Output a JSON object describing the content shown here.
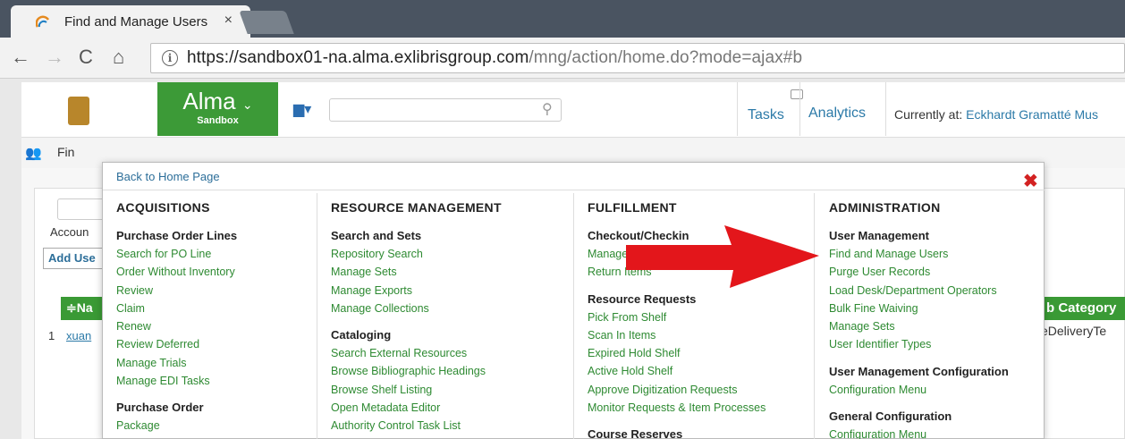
{
  "browser": {
    "tab_title": "Find and Manage Users",
    "tab_close": "×",
    "url_host": "https://sandbox01-na.alma.exlibrisgroup.com",
    "url_path": "/mng/action/home.do?mode=ajax#b"
  },
  "header": {
    "alma_name": "Alma",
    "alma_dropdown": "⌄",
    "alma_sub": "Sandbox",
    "tasks": "Tasks",
    "analytics": "Analytics",
    "currently_prefix": "Currently at:",
    "currently_location": "Eckhardt Gramatté Mus"
  },
  "subbar": {
    "text": "Fin"
  },
  "background": {
    "accoun": "Accoun",
    "add_use": "Add Use",
    "tbl_head": "≑Na",
    "row_num": "1",
    "row_link": "xuan",
    "right_head": "b Category",
    "right_cell": "eDeliveryTe"
  },
  "menu": {
    "back_home": "Back to Home Page",
    "close": "✖",
    "columns": [
      {
        "title": "ACQUISITIONS",
        "groups": [
          {
            "title": "Purchase Order Lines",
            "items": [
              "Search for PO Line",
              "Order Without Inventory",
              "Review",
              "Claim",
              "Renew",
              "Review Deferred",
              "Manage Trials",
              "Manage EDI Tasks"
            ]
          },
          {
            "title": "Purchase Order",
            "items": [
              "Package"
            ]
          }
        ]
      },
      {
        "title": "RESOURCE MANAGEMENT",
        "groups": [
          {
            "title": "Search and Sets",
            "items": [
              "Repository Search",
              "Manage Sets",
              "Manage Exports",
              "Manage Collections"
            ]
          },
          {
            "title": "Cataloging",
            "items": [
              "Search External Resources",
              "Browse Bibliographic Headings",
              "Browse Shelf Listing",
              "Open Metadata Editor",
              "Authority Control Task List"
            ]
          }
        ]
      },
      {
        "title": "FULFILLMENT",
        "groups": [
          {
            "title": "Checkout/Checkin",
            "items": [
              "Manage",
              "Return Items"
            ]
          },
          {
            "title": "Resource Requests",
            "items": [
              "Pick From Shelf",
              "Scan In Items",
              "Expired Hold Shelf",
              "Active Hold Shelf",
              "Approve Digitization Requests",
              "Monitor Requests & Item Processes"
            ]
          },
          {
            "title": "Course Reserves",
            "items": []
          }
        ]
      },
      {
        "title": "ADMINISTRATION",
        "groups": [
          {
            "title": "User Management",
            "items": [
              "Find and Manage Users",
              "Purge User Records",
              "Load Desk/Department Operators",
              "Bulk Fine Waiving",
              "Manage Sets",
              "User Identifier Types"
            ]
          },
          {
            "title": "User Management Configuration",
            "items": [
              "Configuration Menu"
            ]
          },
          {
            "title": "General Configuration",
            "items": [
              "Configuration Menu"
            ]
          }
        ]
      }
    ]
  },
  "colors": {
    "alma_green": "#3c9a37",
    "link_green": "#2e8a32",
    "arrow_red": "#e3161b"
  }
}
